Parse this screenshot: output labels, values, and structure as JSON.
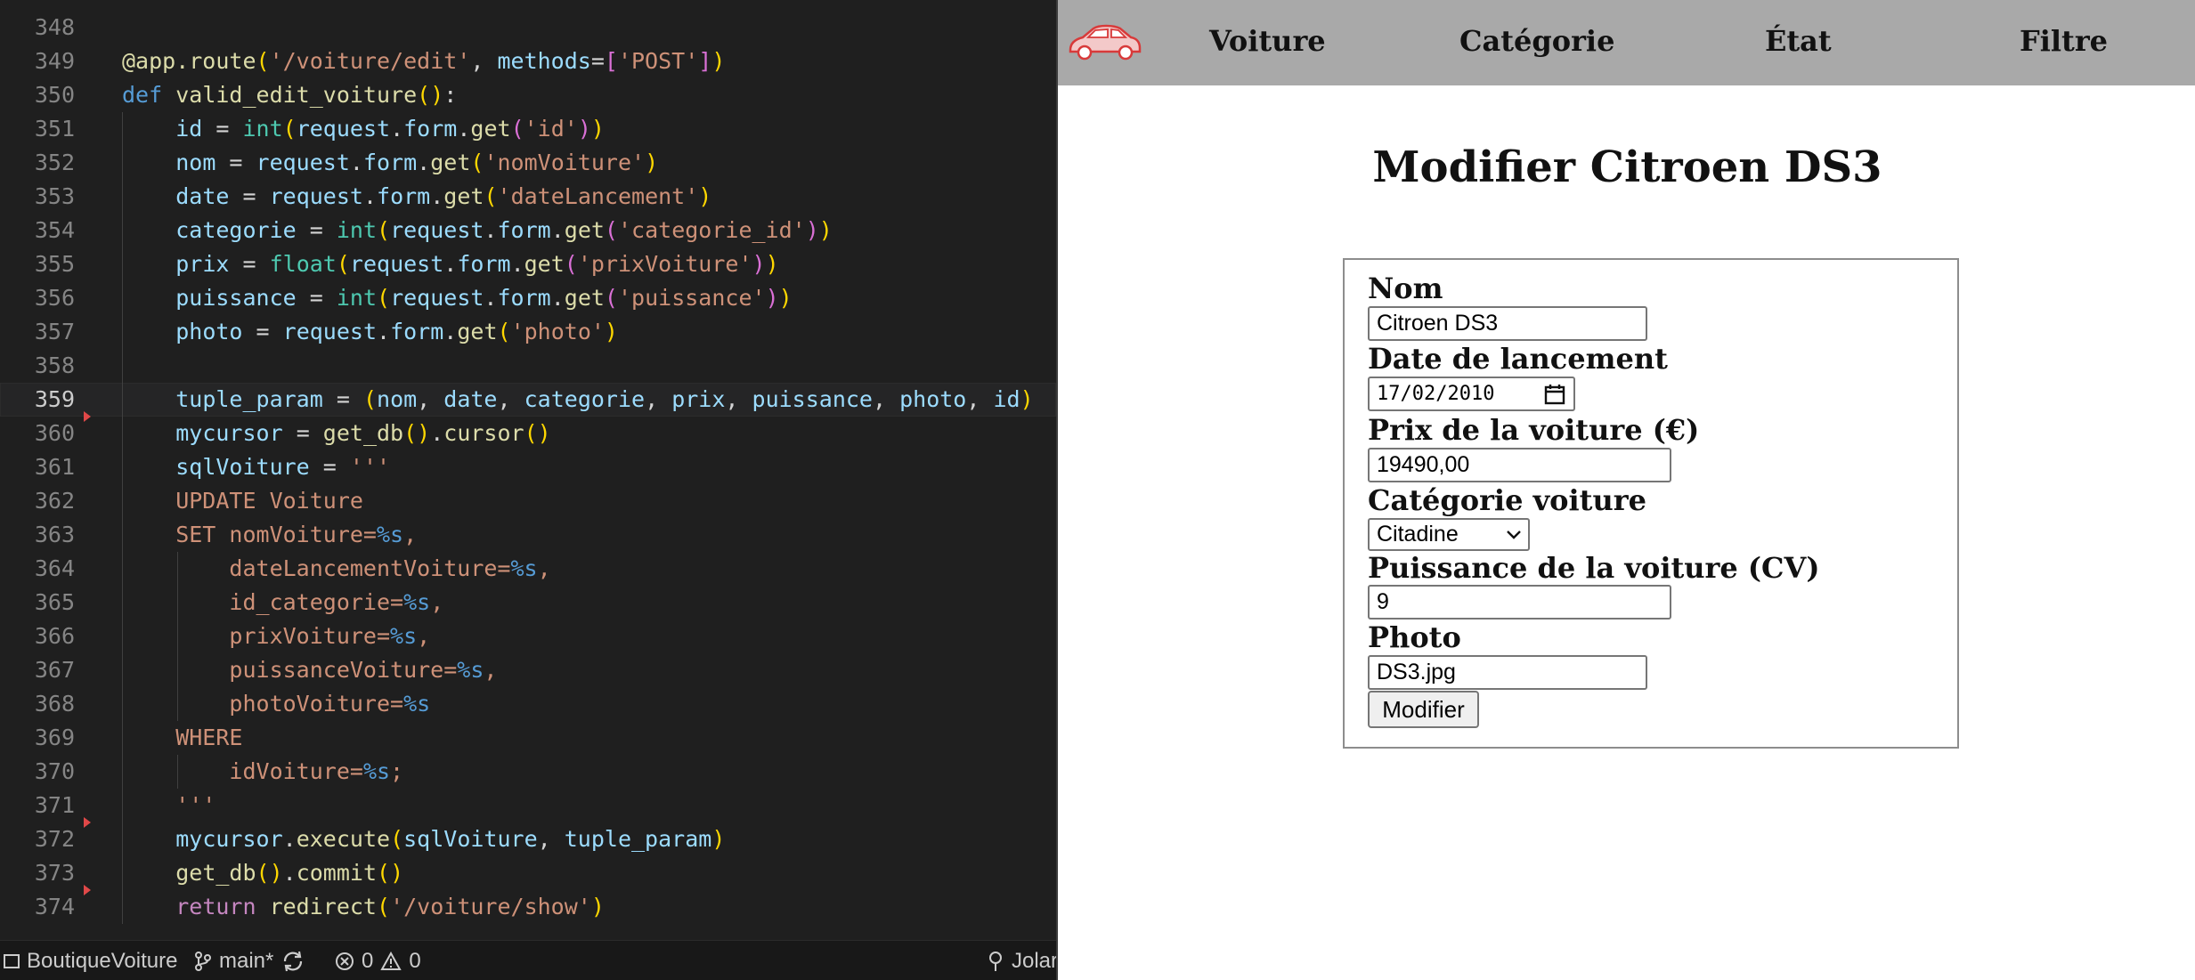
{
  "editor": {
    "lines": [
      {
        "n": "348",
        "tokens": []
      },
      {
        "n": "349",
        "tokens": [
          {
            "c": "fn",
            "t": "@app.route"
          },
          {
            "c": "p1",
            "t": "("
          },
          {
            "c": "st",
            "t": "'/voiture/edit'"
          },
          {
            "c": "op",
            "t": ", "
          },
          {
            "c": "vr",
            "t": "methods"
          },
          {
            "c": "op",
            "t": "="
          },
          {
            "c": "p2",
            "t": "["
          },
          {
            "c": "st",
            "t": "'POST'"
          },
          {
            "c": "p2",
            "t": "]"
          },
          {
            "c": "p1",
            "t": ")"
          }
        ]
      },
      {
        "n": "350",
        "tokens": [
          {
            "c": "kw",
            "t": "def "
          },
          {
            "c": "fn",
            "t": "valid_edit_voiture"
          },
          {
            "c": "p1",
            "t": "()"
          },
          {
            "c": "op",
            "t": ":"
          }
        ]
      },
      {
        "n": "351",
        "tokens": [
          {
            "c": "op",
            "t": "    "
          },
          {
            "c": "vr",
            "t": "id"
          },
          {
            "c": "op",
            "t": " = "
          },
          {
            "c": "bi",
            "t": "int"
          },
          {
            "c": "p1",
            "t": "("
          },
          {
            "c": "vr",
            "t": "request"
          },
          {
            "c": "op",
            "t": "."
          },
          {
            "c": "vr",
            "t": "form"
          },
          {
            "c": "op",
            "t": "."
          },
          {
            "c": "fn",
            "t": "get"
          },
          {
            "c": "p2",
            "t": "("
          },
          {
            "c": "st",
            "t": "'id'"
          },
          {
            "c": "p2",
            "t": ")"
          },
          {
            "c": "p1",
            "t": ")"
          }
        ]
      },
      {
        "n": "352",
        "tokens": [
          {
            "c": "op",
            "t": "    "
          },
          {
            "c": "vr",
            "t": "nom"
          },
          {
            "c": "op",
            "t": " = "
          },
          {
            "c": "vr",
            "t": "request"
          },
          {
            "c": "op",
            "t": "."
          },
          {
            "c": "vr",
            "t": "form"
          },
          {
            "c": "op",
            "t": "."
          },
          {
            "c": "fn",
            "t": "get"
          },
          {
            "c": "p1",
            "t": "("
          },
          {
            "c": "st",
            "t": "'nomVoiture'"
          },
          {
            "c": "p1",
            "t": ")"
          }
        ]
      },
      {
        "n": "353",
        "tokens": [
          {
            "c": "op",
            "t": "    "
          },
          {
            "c": "vr",
            "t": "date"
          },
          {
            "c": "op",
            "t": " = "
          },
          {
            "c": "vr",
            "t": "request"
          },
          {
            "c": "op",
            "t": "."
          },
          {
            "c": "vr",
            "t": "form"
          },
          {
            "c": "op",
            "t": "."
          },
          {
            "c": "fn",
            "t": "get"
          },
          {
            "c": "p1",
            "t": "("
          },
          {
            "c": "st",
            "t": "'dateLancement'"
          },
          {
            "c": "p1",
            "t": ")"
          }
        ]
      },
      {
        "n": "354",
        "tokens": [
          {
            "c": "op",
            "t": "    "
          },
          {
            "c": "vr",
            "t": "categorie"
          },
          {
            "c": "op",
            "t": " = "
          },
          {
            "c": "bi",
            "t": "int"
          },
          {
            "c": "p1",
            "t": "("
          },
          {
            "c": "vr",
            "t": "request"
          },
          {
            "c": "op",
            "t": "."
          },
          {
            "c": "vr",
            "t": "form"
          },
          {
            "c": "op",
            "t": "."
          },
          {
            "c": "fn",
            "t": "get"
          },
          {
            "c": "p2",
            "t": "("
          },
          {
            "c": "st",
            "t": "'categorie_id'"
          },
          {
            "c": "p2",
            "t": ")"
          },
          {
            "c": "p1",
            "t": ")"
          }
        ]
      },
      {
        "n": "355",
        "tokens": [
          {
            "c": "op",
            "t": "    "
          },
          {
            "c": "vr",
            "t": "prix"
          },
          {
            "c": "op",
            "t": " = "
          },
          {
            "c": "bi",
            "t": "float"
          },
          {
            "c": "p1",
            "t": "("
          },
          {
            "c": "vr",
            "t": "request"
          },
          {
            "c": "op",
            "t": "."
          },
          {
            "c": "vr",
            "t": "form"
          },
          {
            "c": "op",
            "t": "."
          },
          {
            "c": "fn",
            "t": "get"
          },
          {
            "c": "p2",
            "t": "("
          },
          {
            "c": "st",
            "t": "'prixVoiture'"
          },
          {
            "c": "p2",
            "t": ")"
          },
          {
            "c": "p1",
            "t": ")"
          }
        ]
      },
      {
        "n": "356",
        "tokens": [
          {
            "c": "op",
            "t": "    "
          },
          {
            "c": "vr",
            "t": "puissance"
          },
          {
            "c": "op",
            "t": " = "
          },
          {
            "c": "bi",
            "t": "int"
          },
          {
            "c": "p1",
            "t": "("
          },
          {
            "c": "vr",
            "t": "request"
          },
          {
            "c": "op",
            "t": "."
          },
          {
            "c": "vr",
            "t": "form"
          },
          {
            "c": "op",
            "t": "."
          },
          {
            "c": "fn",
            "t": "get"
          },
          {
            "c": "p2",
            "t": "("
          },
          {
            "c": "st",
            "t": "'puissance'"
          },
          {
            "c": "p2",
            "t": ")"
          },
          {
            "c": "p1",
            "t": ")"
          }
        ]
      },
      {
        "n": "357",
        "tokens": [
          {
            "c": "op",
            "t": "    "
          },
          {
            "c": "vr",
            "t": "photo"
          },
          {
            "c": "op",
            "t": " = "
          },
          {
            "c": "vr",
            "t": "request"
          },
          {
            "c": "op",
            "t": "."
          },
          {
            "c": "vr",
            "t": "form"
          },
          {
            "c": "op",
            "t": "."
          },
          {
            "c": "fn",
            "t": "get"
          },
          {
            "c": "p1",
            "t": "("
          },
          {
            "c": "st",
            "t": "'photo'"
          },
          {
            "c": "p1",
            "t": ")"
          }
        ]
      },
      {
        "n": "358",
        "tokens": []
      },
      {
        "n": "359",
        "tokens": [
          {
            "c": "op",
            "t": "    "
          },
          {
            "c": "vr",
            "t": "tuple_param"
          },
          {
            "c": "op",
            "t": " = "
          },
          {
            "c": "p1",
            "t": "("
          },
          {
            "c": "vr",
            "t": "nom"
          },
          {
            "c": "op",
            "t": ", "
          },
          {
            "c": "vr",
            "t": "date"
          },
          {
            "c": "op",
            "t": ", "
          },
          {
            "c": "vr",
            "t": "categorie"
          },
          {
            "c": "op",
            "t": ", "
          },
          {
            "c": "vr",
            "t": "prix"
          },
          {
            "c": "op",
            "t": ", "
          },
          {
            "c": "vr",
            "t": "puissance"
          },
          {
            "c": "op",
            "t": ", "
          },
          {
            "c": "vr",
            "t": "photo"
          },
          {
            "c": "op",
            "t": ", "
          },
          {
            "c": "vr",
            "t": "id"
          },
          {
            "c": "p1",
            "t": ")"
          }
        ]
      },
      {
        "n": "360",
        "tokens": [
          {
            "c": "op",
            "t": "    "
          },
          {
            "c": "vr",
            "t": "mycursor"
          },
          {
            "c": "op",
            "t": " = "
          },
          {
            "c": "fn",
            "t": "get_db"
          },
          {
            "c": "p1",
            "t": "()"
          },
          {
            "c": "op",
            "t": "."
          },
          {
            "c": "fn",
            "t": "cursor"
          },
          {
            "c": "p1",
            "t": "()"
          }
        ]
      },
      {
        "n": "361",
        "tokens": [
          {
            "c": "op",
            "t": "    "
          },
          {
            "c": "vr",
            "t": "sqlVoiture"
          },
          {
            "c": "op",
            "t": " = "
          },
          {
            "c": "st",
            "t": "'''"
          }
        ]
      },
      {
        "n": "362",
        "tokens": [
          {
            "c": "st",
            "t": "    UPDATE Voiture"
          }
        ]
      },
      {
        "n": "363",
        "tokens": [
          {
            "c": "st",
            "t": "    SET nomVoiture="
          },
          {
            "c": "sqlp",
            "t": "%s"
          },
          {
            "c": "st",
            "t": ","
          }
        ]
      },
      {
        "n": "364",
        "tokens": [
          {
            "c": "st",
            "t": "        dateLancementVoiture="
          },
          {
            "c": "sqlp",
            "t": "%s"
          },
          {
            "c": "st",
            "t": ","
          }
        ]
      },
      {
        "n": "365",
        "tokens": [
          {
            "c": "st",
            "t": "        id_categorie="
          },
          {
            "c": "sqlp",
            "t": "%s"
          },
          {
            "c": "st",
            "t": ","
          }
        ]
      },
      {
        "n": "366",
        "tokens": [
          {
            "c": "st",
            "t": "        prixVoiture="
          },
          {
            "c": "sqlp",
            "t": "%s"
          },
          {
            "c": "st",
            "t": ","
          }
        ]
      },
      {
        "n": "367",
        "tokens": [
          {
            "c": "st",
            "t": "        puissanceVoiture="
          },
          {
            "c": "sqlp",
            "t": "%s"
          },
          {
            "c": "st",
            "t": ","
          }
        ]
      },
      {
        "n": "368",
        "tokens": [
          {
            "c": "st",
            "t": "        photoVoiture="
          },
          {
            "c": "sqlp",
            "t": "%s"
          }
        ]
      },
      {
        "n": "369",
        "tokens": [
          {
            "c": "st",
            "t": "    WHERE"
          }
        ]
      },
      {
        "n": "370",
        "tokens": [
          {
            "c": "st",
            "t": "        idVoiture="
          },
          {
            "c": "sqlp",
            "t": "%s"
          },
          {
            "c": "st",
            "t": ";"
          }
        ]
      },
      {
        "n": "371",
        "tokens": [
          {
            "c": "st",
            "t": "    '''"
          }
        ]
      },
      {
        "n": "372",
        "tokens": [
          {
            "c": "op",
            "t": "    "
          },
          {
            "c": "vr",
            "t": "mycursor"
          },
          {
            "c": "op",
            "t": "."
          },
          {
            "c": "fn",
            "t": "execute"
          },
          {
            "c": "p1",
            "t": "("
          },
          {
            "c": "vr",
            "t": "sqlVoiture"
          },
          {
            "c": "op",
            "t": ", "
          },
          {
            "c": "vr",
            "t": "tuple_param"
          },
          {
            "c": "p1",
            "t": ")"
          }
        ]
      },
      {
        "n": "373",
        "tokens": [
          {
            "c": "op",
            "t": "    "
          },
          {
            "c": "fn",
            "t": "get_db"
          },
          {
            "c": "p1",
            "t": "()"
          },
          {
            "c": "op",
            "t": "."
          },
          {
            "c": "fn",
            "t": "commit"
          },
          {
            "c": "p1",
            "t": "()"
          }
        ]
      },
      {
        "n": "374",
        "tokens": [
          {
            "c": "op",
            "t": "    "
          },
          {
            "c": "kc",
            "t": "return "
          },
          {
            "c": "fn",
            "t": "redirect"
          },
          {
            "c": "p1",
            "t": "("
          },
          {
            "c": "st",
            "t": "'/voiture/show'"
          },
          {
            "c": "p1",
            "t": ")"
          }
        ]
      }
    ],
    "active_line": "359",
    "gutter_markers": [
      "360",
      "372",
      "374"
    ]
  },
  "statusbar": {
    "project": "BoutiqueVoiture",
    "branch": "main*",
    "errors": "0",
    "warnings": "0",
    "user": "Jolar"
  },
  "browser": {
    "nav": {
      "items": [
        "Voiture",
        "Catégorie",
        "État",
        "Filtre"
      ]
    },
    "title": "Modifier Citroen DS3",
    "form": {
      "nom_label": "Nom",
      "nom_value": "Citroen DS3",
      "date_label": "Date de lancement",
      "date_value": "17/02/2010",
      "prix_label": "Prix de la voiture (€)",
      "prix_value": "19490,00",
      "categorie_label": "Catégorie voiture",
      "categorie_value": "Citadine",
      "puissance_label": "Puissance de la voiture (CV)",
      "puissance_value": "9",
      "photo_label": "Photo",
      "photo_value": "DS3.jpg",
      "submit_label": "Modifier"
    }
  },
  "colors": {
    "editor_bg": "#1f1f1f",
    "navbar_bg": "#a9a9a9",
    "logo_red": "#d83a3a"
  }
}
